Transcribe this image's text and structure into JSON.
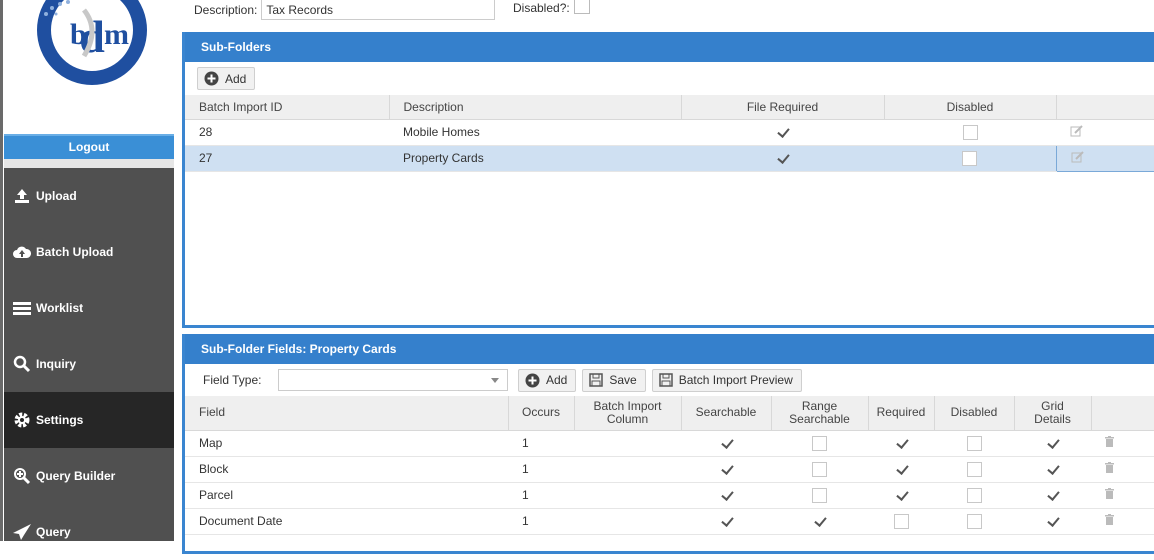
{
  "sidebar": {
    "logout_label": "Logout",
    "items": [
      {
        "label": "Upload",
        "icon": "upload-icon"
      },
      {
        "label": "Batch Upload",
        "icon": "cloud-upload-icon"
      },
      {
        "label": "Worklist",
        "icon": "list-icon"
      },
      {
        "label": "Inquiry",
        "icon": "search-icon"
      },
      {
        "label": "Settings",
        "icon": "gear-icon",
        "active": true
      },
      {
        "label": "Query Builder",
        "icon": "zoom-plus-icon"
      },
      {
        "label": "Query",
        "icon": "send-icon"
      }
    ]
  },
  "header": {
    "description_label": "Description:",
    "description_value": "Tax Records",
    "disabled_label": "Disabled?:"
  },
  "subfolders": {
    "title": "Sub-Folders",
    "add_label": "Add",
    "columns": [
      "Batch Import ID",
      "Description",
      "File Required",
      "Disabled",
      ""
    ],
    "rows": [
      {
        "id": "28",
        "description": "Mobile Homes",
        "file_required": true,
        "disabled": false
      },
      {
        "id": "27",
        "description": "Property Cards",
        "file_required": true,
        "disabled": false,
        "selected": true
      }
    ]
  },
  "fields": {
    "title": "Sub-Folder Fields: Property Cards",
    "field_type_label": "Field Type:",
    "field_type_value": "",
    "add_label": "Add",
    "save_label": "Save",
    "preview_label": "Batch Import Preview",
    "columns": {
      "field": "Field",
      "occurs": "Occurs",
      "batch_col_1": "Batch Import",
      "batch_col_2": "Column",
      "searchable": "Searchable",
      "range_1": "Range",
      "range_2": "Searchable",
      "required": "Required",
      "disabled": "Disabled",
      "grid_1": "Grid",
      "grid_2": "Details"
    },
    "rows": [
      {
        "field": "Map",
        "occurs": "1",
        "searchable": true,
        "range": false,
        "required": true,
        "disabled": false,
        "grid": true
      },
      {
        "field": "Block",
        "occurs": "1",
        "searchable": true,
        "range": false,
        "required": true,
        "disabled": false,
        "grid": true
      },
      {
        "field": "Parcel",
        "occurs": "1",
        "searchable": true,
        "range": false,
        "required": true,
        "disabled": false,
        "grid": true
      },
      {
        "field": "Document Date",
        "occurs": "1",
        "searchable": true,
        "range": true,
        "required": false,
        "disabled": false,
        "grid": true
      }
    ]
  },
  "colors": {
    "accent": "#3580cc",
    "sidebar": "#505050",
    "active_nav": "#262626",
    "selected_row": "#cfe0f2"
  }
}
